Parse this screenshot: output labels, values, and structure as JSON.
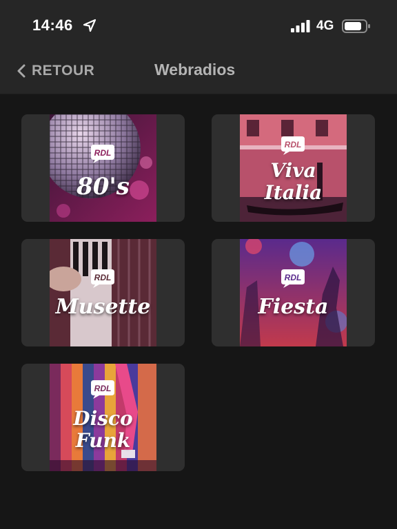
{
  "status": {
    "time": "14:46",
    "network": "4G",
    "icons": [
      "location-arrow-icon",
      "signal-bars-icon",
      "battery-icon"
    ]
  },
  "nav": {
    "back_label": "RETOUR",
    "title": "Webradios"
  },
  "logo_text": "RDL",
  "stations": [
    {
      "name_line1": "80's",
      "name_line2": ""
    },
    {
      "name_line1": "Viva",
      "name_line2": "Italia"
    },
    {
      "name_line1": "Musette",
      "name_line2": ""
    },
    {
      "name_line1": "Fiesta",
      "name_line2": ""
    },
    {
      "name_line1": "Disco",
      "name_line2": "Funk"
    }
  ],
  "colors": {
    "background": "#161616",
    "bar": "#262626",
    "tile": "#2f2f2f",
    "muted_text": "#a9a9a9"
  }
}
